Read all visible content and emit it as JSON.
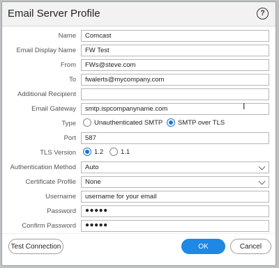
{
  "dialog": {
    "title": "Email Server Profile",
    "help_icon": "help-circle-icon",
    "help_glyph": "?"
  },
  "form": {
    "name": {
      "label": "Name",
      "value": "Comcast"
    },
    "display_name": {
      "label": "Email Display Name",
      "value": "FW Test"
    },
    "from": {
      "label": "From",
      "value": "FWs@steve.com"
    },
    "to": {
      "label": "To",
      "value": "fwalerts@mycompany.com"
    },
    "additional_recipient": {
      "label": "Additional Recipient",
      "value": ""
    },
    "gateway": {
      "label": "Email Gateway",
      "value": "smtp.ispcompanyname.com"
    },
    "type": {
      "label": "Type",
      "options": [
        "Unauthenticated SMTP",
        "SMTP over TLS"
      ],
      "selected": "SMTP over TLS"
    },
    "port": {
      "label": "Port",
      "value": "587"
    },
    "tls_version": {
      "label": "TLS Version",
      "options": [
        "1.2",
        "1.1"
      ],
      "selected": "1.2"
    },
    "auth_method": {
      "label": "Authentication Method",
      "value": "Auto"
    },
    "cert_profile": {
      "label": "Certificate Profile",
      "value": "None"
    },
    "username": {
      "label": "Username",
      "value": "username for your email"
    },
    "password": {
      "label": "Password",
      "value": "●●●●●"
    },
    "confirm_password": {
      "label": "Confirm Password",
      "value": "●●●●●"
    }
  },
  "footer": {
    "test_label": "Test Connection",
    "ok_label": "OK",
    "cancel_label": "Cancel"
  },
  "colors": {
    "accent": "#1e88e5",
    "title_bar": "#f2f2f2"
  }
}
